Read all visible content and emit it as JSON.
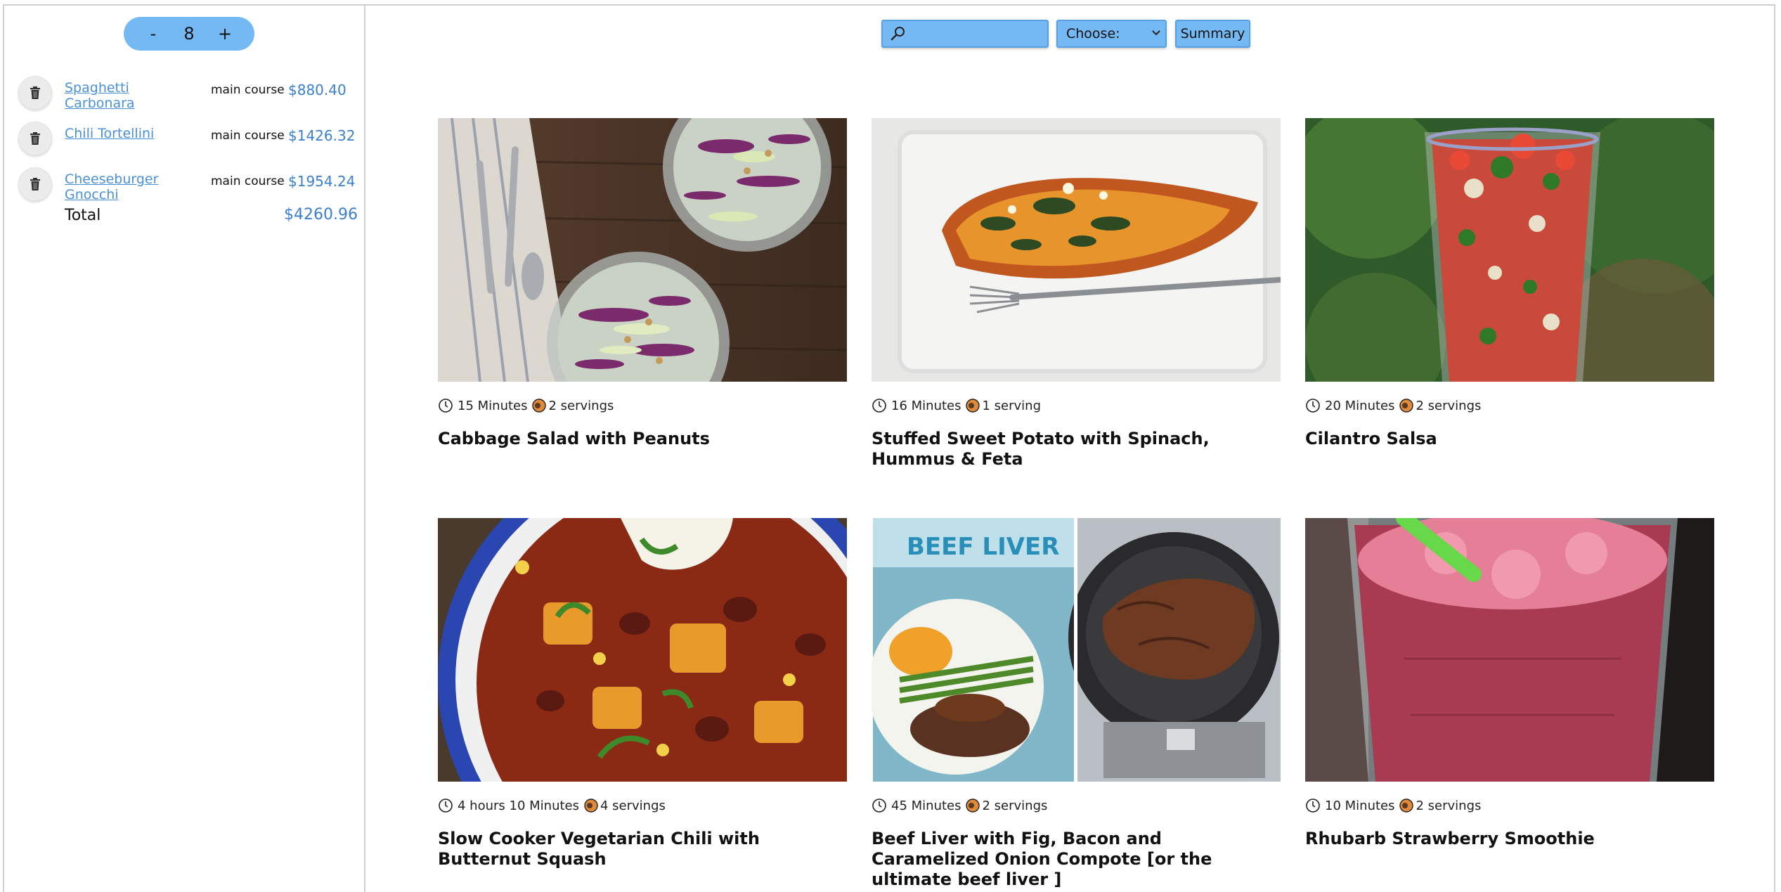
{
  "sidebar": {
    "stepper": {
      "minus": "-",
      "count": "8",
      "plus": "+"
    },
    "items": [
      {
        "name": "Spaghetti Carbonara",
        "course": "main course",
        "price": "$880.40"
      },
      {
        "name": "Chili Tortellini",
        "course": "main course",
        "price": "$1426.32"
      },
      {
        "name": "Cheeseburger Gnocchi",
        "course": "main course",
        "price": "$1954.24"
      }
    ],
    "total_label": "Total",
    "total_value": "$4260.96"
  },
  "toolbar": {
    "search_value": "",
    "select_value": "Choose:",
    "summary_label": "Summary"
  },
  "recipes": [
    {
      "time": "15 Minutes",
      "servings": "2 servings",
      "title": "Cabbage Salad with Peanuts"
    },
    {
      "time": "16 Minutes",
      "servings": "1 serving",
      "title": "Stuffed Sweet Potato with Spinach, Hummus & Feta"
    },
    {
      "time": "20 Minutes",
      "servings": "2 servings",
      "title": "Cilantro Salsa"
    },
    {
      "time": "4 hours 10 Minutes",
      "servings": "4 servings",
      "title": "Slow Cooker Vegetarian Chili with Butternut Squash"
    },
    {
      "time": "45 Minutes",
      "servings": "2 servings",
      "title": "Beef Liver with Fig, Bacon and Caramelized Onion Compote [or the ultimate beef liver ]"
    },
    {
      "time": "10 Minutes",
      "servings": "2 servings",
      "title": "Rhubarb Strawberry Smoothie"
    }
  ],
  "embedded_text": {
    "beef_liver_photo": "BEEF LIVER"
  },
  "colors": {
    "accent": "#74b9f3",
    "link": "#4a90d9",
    "price": "#3a7fd0"
  }
}
